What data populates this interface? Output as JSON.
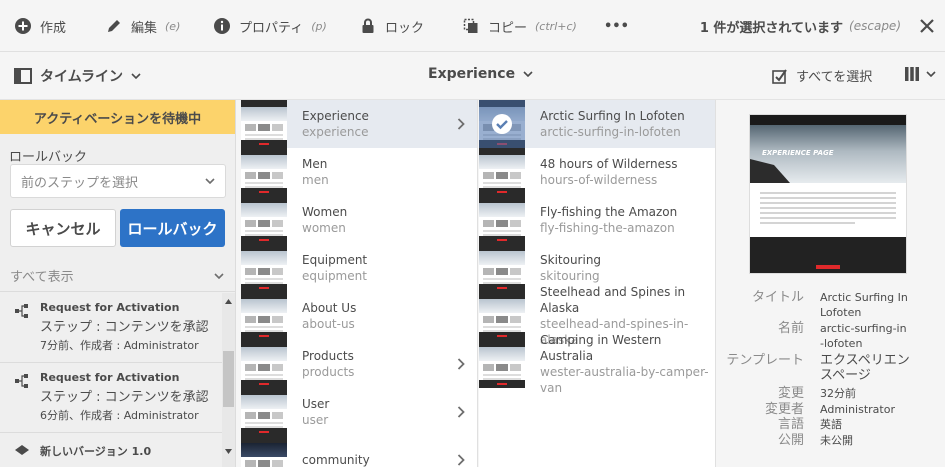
{
  "toolbar": {
    "create": "作成",
    "edit": "編集",
    "edit_shortcut": "(e)",
    "properties": "プロパティ",
    "properties_shortcut": "(p)",
    "lock": "ロック",
    "copy": "コピー",
    "copy_shortcut": "(ctrl+c)",
    "more": "•••",
    "selection_status": "1 件が選択されています",
    "selection_shortcut": "(escape)"
  },
  "header": {
    "rail_label": "タイムライン",
    "breadcrumb": "Experience",
    "select_all": "すべてを選択"
  },
  "rail": {
    "banner": "アクティベーションを待機中",
    "rollback_label": "ロールバック",
    "rollback_placeholder": "前のステップを選択",
    "cancel_button": "キャンセル",
    "rollback_button": "ロールバック",
    "show_all": "すべて表示",
    "items": [
      {
        "title": "Request for Activation",
        "step": "ステップ : コンテンツを承認",
        "meta": "7分前、作成者 : Administrator"
      },
      {
        "title": "Request for Activation",
        "step": "ステップ : コンテンツを承認",
        "meta": "6分前、作成者 : Administrator"
      }
    ],
    "version": "新しいバージョン 1.0"
  },
  "column1": [
    {
      "title": "Experience",
      "name": "experience",
      "children": true,
      "active": true
    },
    {
      "title": "Men",
      "name": "men",
      "children": false
    },
    {
      "title": "Women",
      "name": "women",
      "children": false
    },
    {
      "title": "Equipment",
      "name": "equipment",
      "children": false
    },
    {
      "title": "About Us",
      "name": "about-us",
      "children": false
    },
    {
      "title": "Products",
      "name": "products",
      "children": true
    },
    {
      "title": "User",
      "name": "user",
      "children": true
    },
    {
      "title": "community",
      "name": "",
      "children": true
    }
  ],
  "column2": [
    {
      "title": "Arctic Surfing In Lofoten",
      "name": "arctic-surfing-in-lofoten",
      "selected": true
    },
    {
      "title": "48 hours of Wilderness",
      "name": "hours-of-wilderness"
    },
    {
      "title": "Fly-fishing the Amazon",
      "name": "fly-fishing-the-amazon"
    },
    {
      "title": "Skitouring",
      "name": "skitouring"
    },
    {
      "title": "Steelhead and Spines in Alaska",
      "name": "steelhead-and-spines-in-alaska"
    },
    {
      "title": "Camping in Western Australia",
      "name": "wester-australia-by-camper-van"
    }
  ],
  "detail": {
    "preview_banner": "EXPERIENCE PAGE",
    "title_label": "タイトル",
    "title_value": "Arctic Surfing In Lofoten",
    "name_label": "名前",
    "name_value": "arctic-surfing-in-lofoten",
    "template_label": "テンプレート",
    "template_value": "エクスペリエンスページ",
    "modified_label": "変更",
    "modified_value": "32分前",
    "modifier_label": "変更者",
    "modifier_value": "Administrator",
    "language_label": "言語",
    "language_value": "英語",
    "published_label": "公開",
    "published_value": "未公開"
  },
  "colors": {
    "banner": "#fcd36b",
    "primary": "#2d73c7",
    "active_row": "#e6eaf0"
  }
}
